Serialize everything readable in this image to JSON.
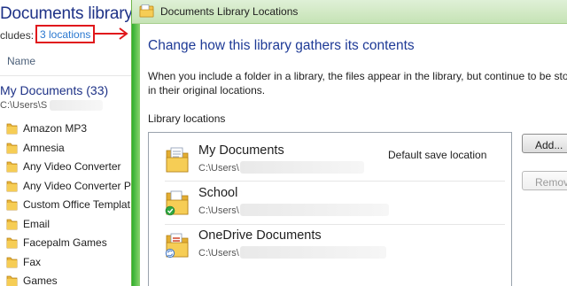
{
  "explorer": {
    "library_title": "Documents library",
    "includes_prefix": "cludes:",
    "includes_link": "3 locations",
    "column_name": "Name",
    "folder_title": "My Documents (33)",
    "folder_path": "C:\\Users\\S",
    "folders": [
      {
        "name": "Amazon MP3",
        "icon": "folder-icon"
      },
      {
        "name": "Amnesia",
        "icon": "folder-icon"
      },
      {
        "name": "Any Video Converter",
        "icon": "folder-icon"
      },
      {
        "name": "Any Video Converter Pr",
        "icon": "folder-icon"
      },
      {
        "name": "Custom Office Templat",
        "icon": "folder-icon"
      },
      {
        "name": "Email",
        "icon": "folder-icon"
      },
      {
        "name": "Facepalm Games",
        "icon": "folder-icon"
      },
      {
        "name": "Fax",
        "icon": "folder-icon"
      },
      {
        "name": "Games",
        "icon": "folder-icon"
      }
    ]
  },
  "dialog": {
    "title": "Documents Library Locations",
    "heading": "Change how this library gathers its contents",
    "description_line1": "When you include a folder in a library, the files appear in the library, but continue to be sto",
    "description_line2": "in their original locations.",
    "locations_label": "Library locations",
    "locations": [
      {
        "name": "My Documents",
        "path": "C:\\Users\\",
        "note": "Default save location",
        "icon": "documents-folder-icon"
      },
      {
        "name": "School",
        "path": "C:\\Users\\",
        "note": "",
        "icon": "shared-folder-check-icon"
      },
      {
        "name": "OneDrive Documents",
        "path": "C:\\Users\\",
        "note": "",
        "icon": "onedrive-folder-sync-icon"
      }
    ],
    "add_button": "Add...",
    "remove_button": "Remov"
  },
  "colors": {
    "accent_green": "#2fae2c",
    "heading_blue": "#1e3a96",
    "highlight_red": "#e0181c",
    "link_blue": "#2a78d0"
  }
}
